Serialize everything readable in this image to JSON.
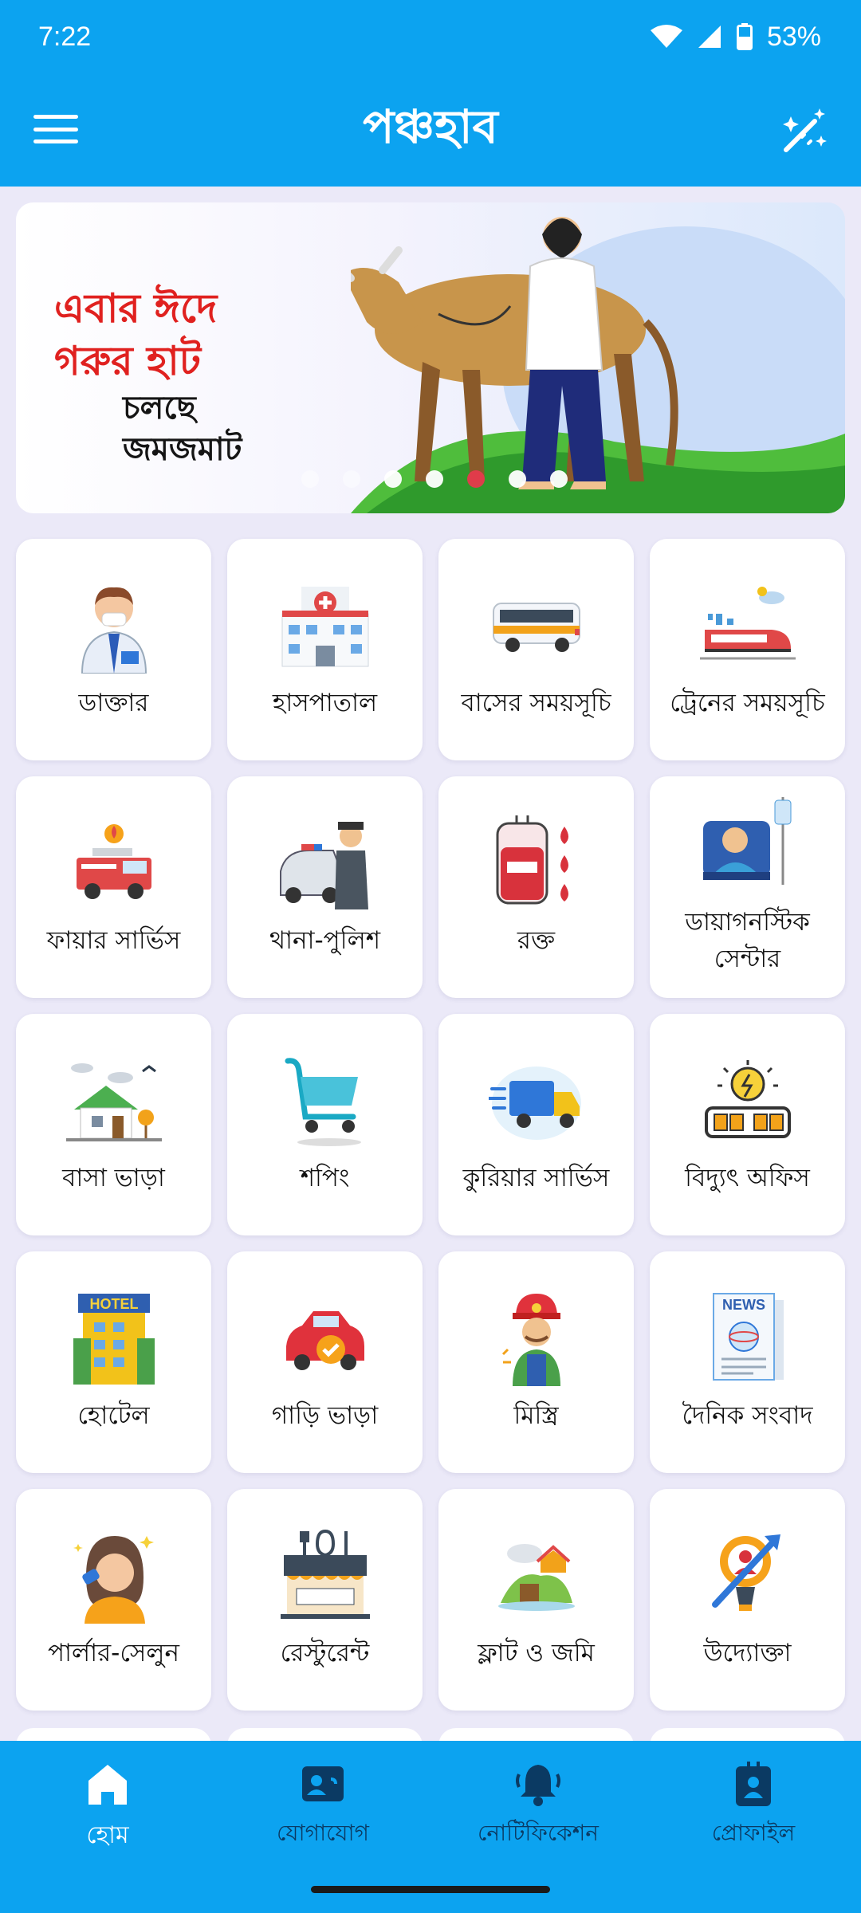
{
  "status_bar": {
    "time": "7:22",
    "battery": "53%"
  },
  "app_bar": {
    "title": "পঞ্চহাব"
  },
  "banner": {
    "lines": [
      "এবার ঈদে",
      "গরুর হাট",
      "চলছে",
      "জমজমাট"
    ],
    "slide_count": 7,
    "active_slide": 4
  },
  "tiles": [
    {
      "label": "ডাক্তার",
      "icon": "doctor-icon"
    },
    {
      "label": "হাসপাতাল",
      "icon": "hospital-icon"
    },
    {
      "label": "বাসের সময়সূচি",
      "icon": "bus-icon"
    },
    {
      "label": "ট্রেনের সময়সূচি",
      "icon": "train-icon"
    },
    {
      "label": "ফায়ার সার্ভিস",
      "icon": "fire-truck-icon"
    },
    {
      "label": "থানা-পুলিশ",
      "icon": "police-icon"
    },
    {
      "label": "রক্ত",
      "icon": "blood-bag-icon"
    },
    {
      "label": "ডায়াগনস্টিক সেন্টার",
      "icon": "diagnostic-icon"
    },
    {
      "label": "বাসা ভাড়া",
      "icon": "house-icon"
    },
    {
      "label": "শপিং",
      "icon": "shopping-cart-icon"
    },
    {
      "label": "কুরিয়ার সার্ভিস",
      "icon": "courier-truck-icon"
    },
    {
      "label": "বিদ্যুৎ অফিস",
      "icon": "electricity-icon"
    },
    {
      "label": "হোটেল",
      "icon": "hotel-icon"
    },
    {
      "label": "গাড়ি ভাড়া",
      "icon": "car-icon"
    },
    {
      "label": "মিস্ত্রি",
      "icon": "mechanic-icon"
    },
    {
      "label": "দৈনিক সংবাদ",
      "icon": "newspaper-icon"
    },
    {
      "label": "পার্লার-সেলুন",
      "icon": "parlour-icon"
    },
    {
      "label": "রেস্টুরেন্ট",
      "icon": "restaurant-icon"
    },
    {
      "label": "ফ্লাট ও জমি",
      "icon": "land-icon"
    },
    {
      "label": "উদ্যোক্তা",
      "icon": "entrepreneur-icon"
    }
  ],
  "hotel_sign": "HOTEL",
  "news_sign": "NEWS",
  "bottom_nav": [
    {
      "label": "হোম",
      "icon": "home-icon",
      "active": true
    },
    {
      "label": "যোগাযোগ",
      "icon": "contacts-icon",
      "active": false
    },
    {
      "label": "নোটিফিকেশন",
      "icon": "bell-icon",
      "active": false
    },
    {
      "label": "প্রোফাইল",
      "icon": "profile-icon",
      "active": false
    }
  ],
  "colors": {
    "primary": "#0ca3f0",
    "background": "#ebe9f8",
    "nav_inactive": "#0b3a63",
    "banner_red": "#e0211f"
  }
}
